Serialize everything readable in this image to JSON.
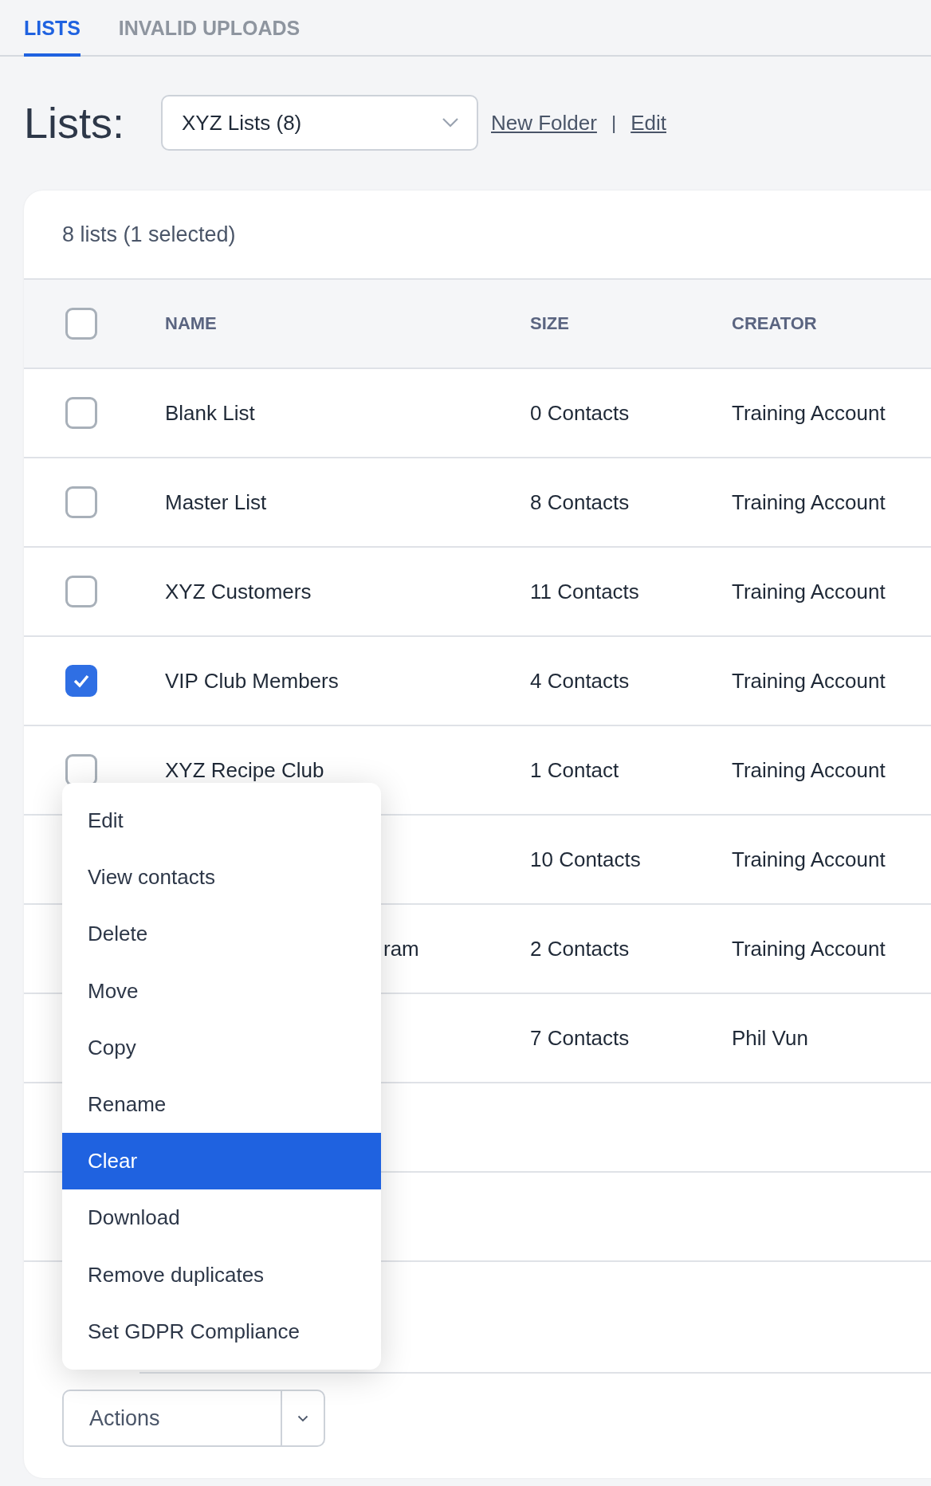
{
  "tabs": [
    {
      "label": "LISTS",
      "selected": true
    },
    {
      "label": "INVALID UPLOADS",
      "selected": false
    }
  ],
  "heading": "Lists:",
  "folder_select": {
    "value": "XYZ Lists (8)"
  },
  "links": [
    "New Folder",
    "Edit"
  ],
  "link_separator": "|",
  "summary": "8 lists (1 selected)",
  "table": {
    "header_checked": false,
    "columns": [
      "NAME",
      "SIZE",
      "CREATOR"
    ],
    "rows": [
      {
        "checked": false,
        "name": "Blank List",
        "size": "0 Contacts",
        "creator": "Training Account"
      },
      {
        "checked": false,
        "name": "Master List",
        "size": "8 Contacts",
        "creator": "Training Account"
      },
      {
        "checked": false,
        "name": "XYZ Customers",
        "size": "11 Contacts",
        "creator": "Training Account"
      },
      {
        "checked": true,
        "name": "VIP Club Members",
        "size": "4 Contacts",
        "creator": "Training Account"
      },
      {
        "checked": false,
        "name": "XYZ Recipe Club",
        "size": "1 Contact",
        "creator": "Training Account"
      },
      {
        "size": "10 Contacts",
        "creator": "Training Account"
      },
      {
        "name_tail": "ram",
        "size": "2 Contacts",
        "creator": "Training Account"
      },
      {
        "size": "7 Contacts",
        "creator": "Phil Vun"
      },
      {},
      {},
      {}
    ]
  },
  "context_menu": [
    {
      "label": "Edit",
      "selected": false
    },
    {
      "label": "View contacts",
      "selected": false
    },
    {
      "label": "Delete",
      "selected": false
    },
    {
      "label": "Move",
      "selected": false
    },
    {
      "label": "Copy",
      "selected": false
    },
    {
      "label": "Rename",
      "selected": false
    },
    {
      "label": "Clear",
      "selected": true
    },
    {
      "label": "Download",
      "selected": false
    },
    {
      "label": "Remove duplicates",
      "selected": false
    },
    {
      "label": "Set GDPR Compliance",
      "selected": false
    }
  ],
  "actions_button": "Actions"
}
